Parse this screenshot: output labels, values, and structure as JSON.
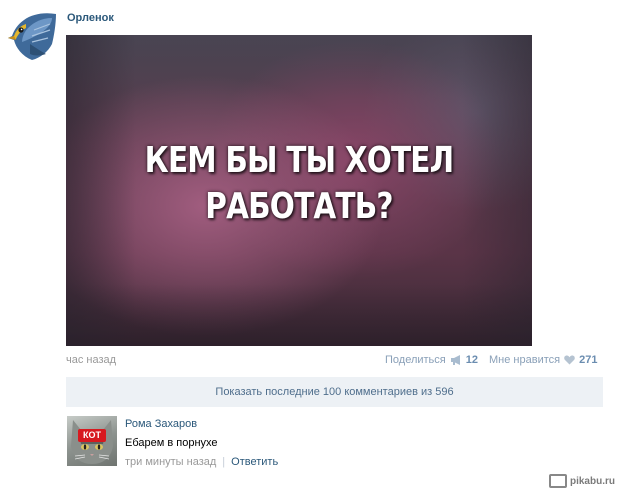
{
  "post": {
    "author": "Орленок",
    "image_text_line1": "КЕМ БЫ ТЫ ХОТЕЛ",
    "image_text_line2": "РАБОТАТЬ?",
    "time": "час назад",
    "share_label": "Поделиться",
    "share_count": "12",
    "like_label": "Мне нравится",
    "like_count": "271"
  },
  "comments_bar": {
    "label": "Показать последние 100 комментариев из 596"
  },
  "comment": {
    "avatar_label": "КОТ",
    "author": "Рома Захаров",
    "text": "Ебарем в порнухе",
    "time": "три минуты назад",
    "separator": "|",
    "reply_label": "Ответить"
  },
  "watermark": "pikabu.ru",
  "icons": {
    "share": "megaphone-icon",
    "like": "heart-icon",
    "avatar": "eagle-icon"
  },
  "colors": {
    "link": "#2b587a",
    "muted": "#999999",
    "bar_bg": "#edf1f5"
  }
}
